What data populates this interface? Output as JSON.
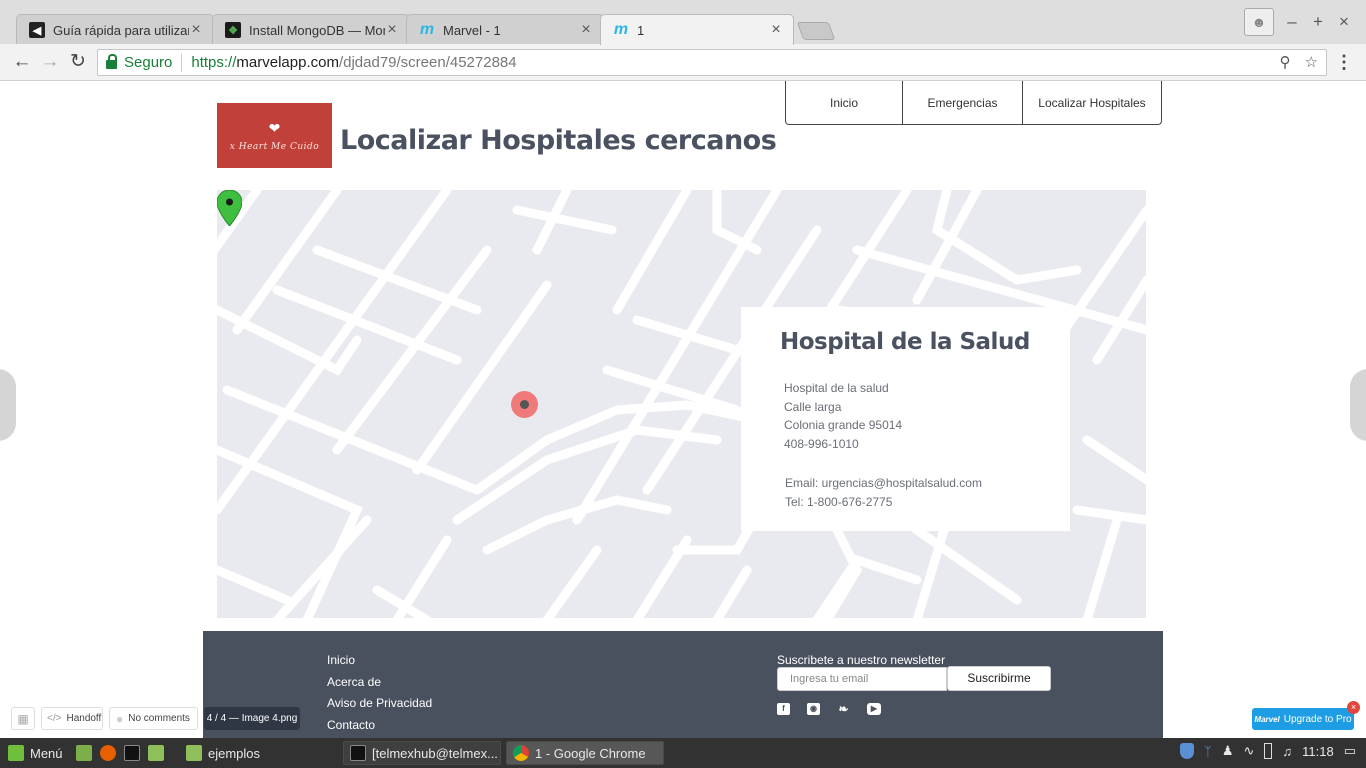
{
  "browser": {
    "tabs": [
      {
        "title": "Guía rápida para utilizar",
        "icon": "guide-favicon-icon",
        "active": false
      },
      {
        "title": "Install MongoDB — Mon",
        "icon": "mongodb-leaf-icon",
        "active": false
      },
      {
        "title": "Marvel - 1",
        "icon": "marvel-m-icon",
        "active": false
      },
      {
        "title": "1",
        "icon": "marvel-m-icon",
        "active": true
      }
    ],
    "secure_label": "Seguro",
    "url": {
      "scheme": "https://",
      "host": "marvelapp.com",
      "path": "/djdad79/screen/45272884"
    }
  },
  "site": {
    "logo_text": "x Heart Me Cuido",
    "title": "Localizar Hospitales cercanos",
    "nav": [
      "Inicio",
      "Emergencias",
      "Localizar Hospitales"
    ],
    "hospital": {
      "name": "Hospital de la Salud",
      "address_lines": [
        "Hospital de la salud",
        "Calle larga",
        "Colonia grande 95014",
        "408-996-1010"
      ],
      "email": "Email: urgencias@hospitalsalud.com",
      "phone": "Tel: 1-800-676-2775"
    },
    "footer": {
      "links": [
        "Inicio",
        "Acerca de",
        "Aviso de Privacidad",
        "Contacto"
      ],
      "newsletter_label": "Suscribete a nuestro  newsletter",
      "email_placeholder": "Ingresa tu email",
      "subscribe_label": "Suscribirme",
      "social_icons": [
        "facebook-icon",
        "instagram-icon",
        "twitter-icon",
        "youtube-icon"
      ]
    }
  },
  "marvel": {
    "handoff": "Handoff",
    "comments": "No comments",
    "image_counter": "4 / 4 — Image 4.png",
    "upgrade": "Upgrade to Pro",
    "brand": "Marvel"
  },
  "taskbar": {
    "menu_label": "Menú",
    "windows": [
      "ejemplos",
      "[telmexhub@telmex...",
      "1 - Google Chrome"
    ],
    "clock": "11:18"
  },
  "colors": {
    "logo_bg": "#c1413a",
    "footer_bg": "#4a515e",
    "map_bg": "#e8eaef",
    "secure_green": "#188038",
    "marker_red": "#f07a7a",
    "marker_green": "#3fbf3f",
    "marvel_blue": "#1e9de4"
  }
}
